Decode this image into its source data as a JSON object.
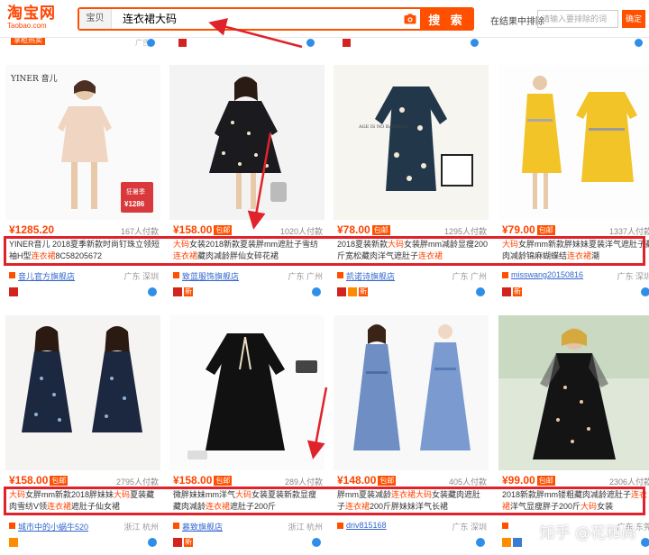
{
  "header": {
    "logo_main": "淘宝网",
    "logo_sub": "Taobao.com",
    "search_scope": "宝贝",
    "search_value": "连衣裙大码",
    "search_button": "搜 索",
    "filter_label": "在结果中排除",
    "filter_placeholder": "请输入要排除的词",
    "filter_button": "确定"
  },
  "partial_row": {
    "badge": "掌柜热卖",
    "gray_text": "广告"
  },
  "products": [
    {
      "price": "¥1285.20",
      "post_tag": "",
      "sales": "167人付款",
      "title_parts": [
        [
          "YINER音儿 2018夏季新款时尚钉珠立领短袖H型",
          ""
        ],
        [
          "连衣裙",
          "hl"
        ],
        [
          "8C58205672",
          ""
        ]
      ],
      "shop": "音儿官方旗舰店",
      "location": "广东 深圳",
      "badges": [
        "tmall"
      ],
      "img_tag1": "狂暑季",
      "img_tag2": "¥1286",
      "img_brand": "YINER 音儿"
    },
    {
      "price": "¥158.00",
      "post_tag": "包邮",
      "sales": "1020人付款",
      "title_parts": [
        [
          "大码",
          "hl"
        ],
        [
          "女装2018新款夏装胖mm遮肚子雪纺",
          ""
        ],
        [
          "连衣裙",
          "hl"
        ],
        [
          "藏肉减龄胖仙女碎花裙",
          ""
        ]
      ],
      "shop": "致蓝服饰旗舰店",
      "location": "广东 广州",
      "badges": [
        "tmall",
        "new"
      ]
    },
    {
      "price": "¥78.00",
      "post_tag": "包邮",
      "sales": "1295人付款",
      "title_parts": [
        [
          "2018夏装新款",
          ""
        ],
        [
          "大码",
          "hl"
        ],
        [
          "女装胖mm减龄显瘦200斤宽松藏肉洋气遮肚子",
          ""
        ],
        [
          "连衣裙",
          "hl"
        ]
      ],
      "shop": "凯诺诗旗舰店",
      "location": "广东 广州",
      "badges": [
        "tmall",
        "orange",
        "new"
      ],
      "img_text": "AGE IS NO BARRIER"
    },
    {
      "price": "¥79.00",
      "post_tag": "包邮",
      "sales": "1337人付款",
      "title_parts": [
        [
          "大码",
          "hl"
        ],
        [
          "女胖mm新款胖妹妹夏装洋气遮肚子藏肉减龄锦麻蝴蝶结",
          ""
        ],
        [
          "连衣裙",
          "hl"
        ],
        [
          "潮",
          ""
        ]
      ],
      "shop": "misswang20150816",
      "location": "广东 深圳",
      "badges": [
        "tmall",
        "new"
      ]
    },
    {
      "price": "¥158.00",
      "post_tag": "包邮",
      "sales": "2795人付款",
      "title_parts": [
        [
          "大码",
          "hl"
        ],
        [
          "女胖mm新款2018胖妹妹",
          ""
        ],
        [
          "大码",
          "hl"
        ],
        [
          "夏装藏肉雪纺V领",
          ""
        ],
        [
          "连衣裙",
          "hl"
        ],
        [
          "遮肚子仙女裙",
          ""
        ]
      ],
      "shop": "城市中的小蜗牛520",
      "location": "浙江 杭州",
      "badges": [
        "gold"
      ]
    },
    {
      "price": "¥158.00",
      "post_tag": "包邮",
      "sales": "289人付款",
      "title_parts": [
        [
          "微胖妹妹mm洋气",
          ""
        ],
        [
          "大码",
          "hl"
        ],
        [
          "女装夏装新款显瘦藏肉减龄",
          ""
        ],
        [
          "连衣裙",
          "hl"
        ],
        [
          "遮肚子200斤",
          ""
        ]
      ],
      "shop": "慕致旗舰店",
      "location": "浙江 杭州",
      "badges": [
        "tmall",
        "new"
      ]
    },
    {
      "price": "¥148.00",
      "post_tag": "包邮",
      "sales": "405人付款",
      "title_parts": [
        [
          "胖mm夏装减龄",
          ""
        ],
        [
          "连衣裙",
          "hl"
        ],
        [
          "大码",
          "hl"
        ],
        [
          "女装藏肉遮肚子",
          ""
        ],
        [
          "连衣裙",
          "hl"
        ],
        [
          "200斤胖妹妹洋气长裙",
          ""
        ]
      ],
      "shop": "driv815168",
      "location": "广东 深圳",
      "badges": []
    },
    {
      "price": "¥99.00",
      "post_tag": "包邮",
      "sales": "2306人付款",
      "title_parts": [
        [
          "2018新款胖mm镂粗藏肉减龄遮肚子",
          ""
        ],
        [
          "连衣裙",
          "hl"
        ],
        [
          "洋气显瘦胖子200斤",
          ""
        ],
        [
          "大码",
          "hl"
        ],
        [
          "女装",
          ""
        ]
      ],
      "shop": "",
      "location": "广东 东莞",
      "badges": [
        "gold",
        "blue"
      ]
    }
  ],
  "watermark": "知乎 @花和尚",
  "colors": {
    "brand": "#ff5000",
    "highlight": "#ff4400",
    "annotation": "#e0232b"
  }
}
